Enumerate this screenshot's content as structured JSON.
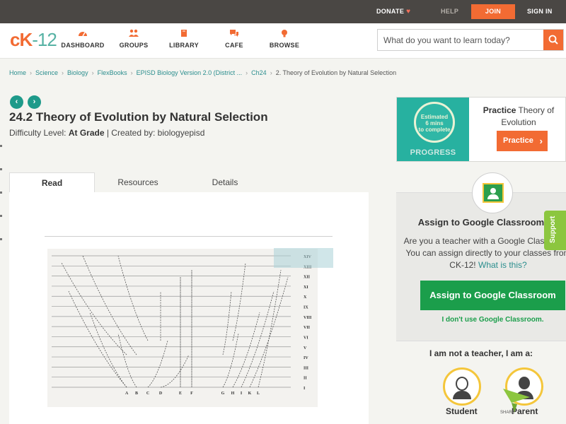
{
  "topbar": {
    "donate": "DONATE",
    "help": "HELP",
    "join": "JOIN",
    "signin": "SIGN IN"
  },
  "header": {
    "logo_ck": "cK",
    "logo_dash": "-",
    "logo_num": "12",
    "nav": [
      {
        "label": "DASHBOARD",
        "icon": "dashboard-icon"
      },
      {
        "label": "GROUPS",
        "icon": "groups-icon"
      },
      {
        "label": "LIBRARY",
        "icon": "library-icon"
      },
      {
        "label": "CAFE",
        "icon": "cafe-icon"
      },
      {
        "label": "BROWSE",
        "icon": "browse-icon"
      }
    ],
    "search_placeholder": "What do you want to learn today?"
  },
  "breadcrumb": [
    "Home",
    "Science",
    "Biology",
    "FlexBooks",
    "EPISD Biology Version 2.0 (District ...",
    "Ch24"
  ],
  "breadcrumb_current": "2. Theory of Evolution by Natural Selection",
  "article": {
    "title": "24.2 Theory of Evolution by Natural Selection",
    "difficulty_label": "Difficulty Level:",
    "difficulty_value": "At Grade",
    "created_by": "| Created by: biologyepisd"
  },
  "tabs": [
    {
      "label": "Read",
      "active": true
    },
    {
      "label": "Resources",
      "active": false
    },
    {
      "label": "Details",
      "active": false
    }
  ],
  "figure": {
    "row_labels": [
      "XIV",
      "XIII",
      "XII",
      "XI",
      "X",
      "IX",
      "VIII",
      "VII",
      "VI",
      "V",
      "IV",
      "III",
      "II",
      "I"
    ],
    "col_labels": [
      "A",
      "B",
      "C",
      "D",
      "E",
      "F",
      "G",
      "H",
      "I",
      "K",
      "L"
    ]
  },
  "practice": {
    "estimated": "Estimated",
    "mins": "6 mins",
    "to_complete": "to complete",
    "progress_label": "PROGRESS",
    "title_bold": "Practice",
    "title_rest": " Theory of Evolution",
    "button": "Practice"
  },
  "classroom": {
    "title": "Assign to Google Classroom",
    "desc": "Are you a teacher with a Google Classroom? You can assign directly to your classes from CK-12!",
    "link": "What is this?",
    "button": "Assign to Google Classroom",
    "no_link": "I don't use Google Classroom."
  },
  "support": "Support",
  "roles": {
    "title": "I am not a teacher, I am a:",
    "student": "Student",
    "parent": "Parent",
    "share": "SHARE"
  },
  "colors": {
    "accent": "#f26b33",
    "teal": "#1e9a8a",
    "google_green": "#1b9e4b"
  }
}
